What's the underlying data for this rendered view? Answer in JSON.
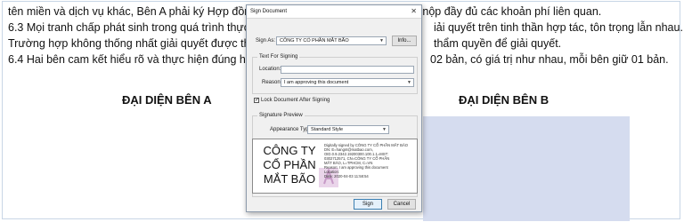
{
  "document": {
    "lines": [
      "tên miền và dịch vụ khác, Bên A phải ký Hợp đồng duy trì tên miền, dịch vụ khác và nộp đầy đủ các khoản phí liên quan.",
      "6.3 Mọi tranh chấp phát sinh trong quá trình thực h",
      "iải quyết trên tinh thần hợp tác, tôn trọng lẫn nhau.",
      "Trường hợp không thống nhất giải quyết được thì v",
      "thẩm quyền để giải quyết.",
      "6.4 Hai bên cam kết hiểu rõ và thực hiện đúng hợp",
      "02 bản, có giá trị như nhau, mỗi bên giữ 01 bản."
    ],
    "party_a": "ĐẠI DIỆN BÊN A",
    "party_b": "ĐẠI DIỆN BÊN B",
    "signature_b_color": "#d5dcef"
  },
  "dialog": {
    "title": "Sign Document",
    "close_icon": "close-icon",
    "sign_as_label": "Sign As:",
    "sign_as_value": "CÔNG TY CỔ PHẦN MẮT BÃO",
    "info_button": "Info...",
    "text_for_signing_title": "Text For Signing",
    "location_label": "Location:",
    "location_value": "",
    "reason_label": "Reason:",
    "reason_value": "I am approving this document",
    "lock_label": "Lock Document After Signing",
    "lock_checked": "✓",
    "signature_preview_title": "Signature Preview",
    "appearance_label": "Appearance Type:",
    "appearance_value": "Standard Style",
    "preview_name": "CÔNG TY CỔ PHẦN MẮT BÃO",
    "preview_details": [
      "Digitally signed by CÔNG TY CỔ PHẦN MẮT BÃO",
      "DN: E=hangnt@matbao.com,",
      "OID.0.9.2342.19200300.100.1.1=MST:",
      "0302712571, CN=CÔNG TY CỔ PHẦN",
      "MẮT BÃO, L=TPHCM, C=VN",
      "Reason: I am approving this document",
      "Location:",
      "Date: 2020-04-03 11:58:54"
    ],
    "sign_button": "Sign",
    "cancel_button": "Cancel"
  }
}
